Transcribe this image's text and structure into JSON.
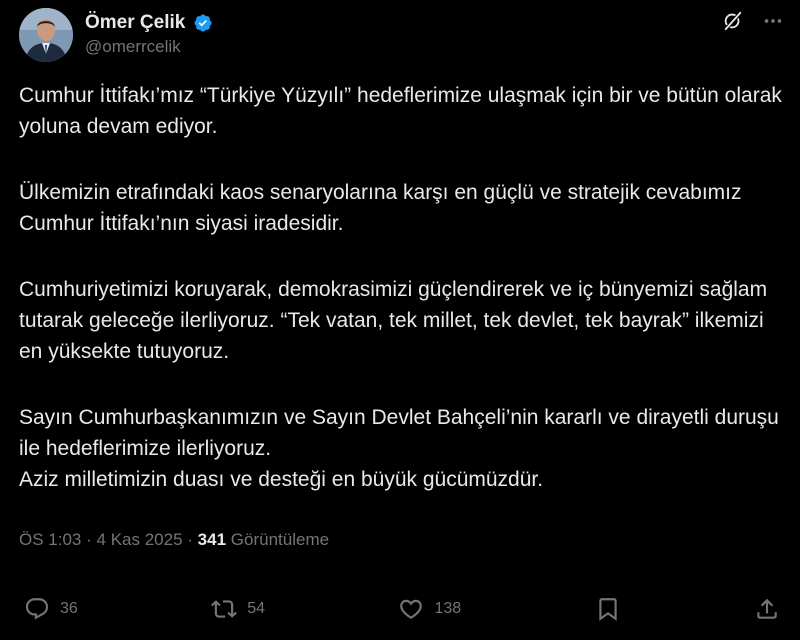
{
  "author": {
    "display_name": "Ömer Çelik",
    "handle": "@omerrcelik"
  },
  "icons": {
    "verified": "verified-badge-icon",
    "grok": "grok-icon",
    "more": "more-options-icon",
    "reply": "reply-icon",
    "repost": "repost-icon",
    "like": "like-icon",
    "bookmark": "bookmark-icon",
    "share": "share-icon"
  },
  "colors": {
    "background": "#000000",
    "text": "#e7e9ea",
    "secondary": "#71767b",
    "verified": "#1d9bf0"
  },
  "tweet": {
    "paragraphs": [
      "Cumhur İttifakı’mız “Türkiye Yüzyılı” hedeflerimize ulaşmak için bir ve bütün olarak yoluna devam ediyor.",
      "Ülkemizin etrafındaki kaos senaryolarına karşı en güçlü ve stratejik cevabımız Cumhur İttifakı’nın siyasi iradesidir.",
      "Cumhuriyetimizi koruyarak, demokrasimizi güçlendirerek ve iç bünyemizi sağlam tutarak geleceğe ilerliyoruz. “Tek vatan, tek millet, tek devlet, tek bayrak” ilkemizi en yüksekte tutuyoruz.",
      "Sayın Cumhurbaşkanımızın ve Sayın Devlet Bahçeli’nin kararlı ve dirayetli duruşu ile hedeflerimize ilerliyoruz.\nAziz milletimizin duası ve desteği en büyük gücümüzdür."
    ]
  },
  "meta": {
    "time": "ÖS 1:03",
    "separator": "·",
    "date": "4 Kas 2025",
    "views_count": "341",
    "views_label": "Görüntüleme"
  },
  "actions": {
    "replies": "36",
    "reposts": "54",
    "likes": "138"
  }
}
